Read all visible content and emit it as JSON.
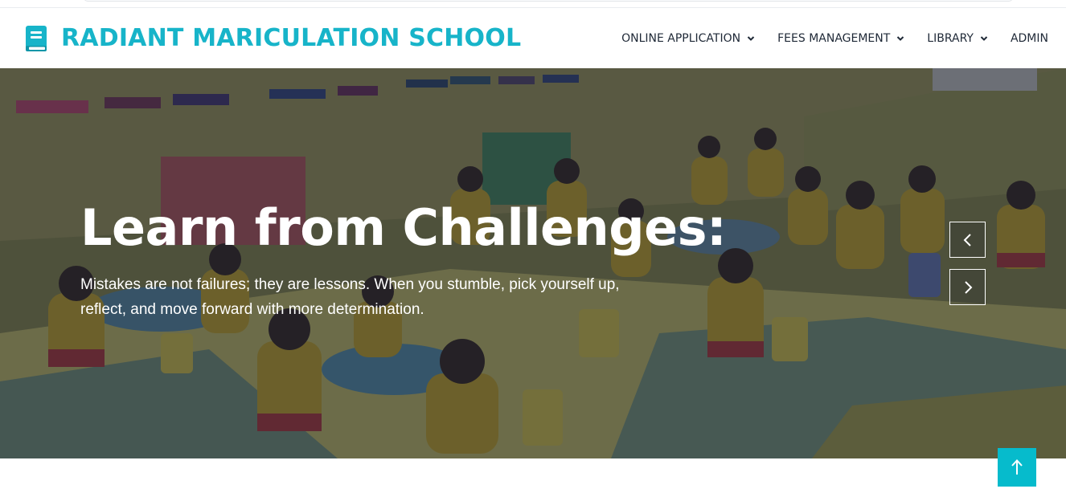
{
  "brand": {
    "name": "RADIANT MARICULATION SCHOOL",
    "icon": "book-icon",
    "color": "#17b4c9"
  },
  "nav": {
    "items": [
      {
        "label": "ONLINE APPLICATION",
        "has_dropdown": true
      },
      {
        "label": "FEES MANAGEMENT",
        "has_dropdown": true
      },
      {
        "label": "LIBRARY",
        "has_dropdown": true
      },
      {
        "label": "ADMIN",
        "has_dropdown": false
      }
    ]
  },
  "hero": {
    "title": "Learn from Challenges:",
    "text": "Mistakes are not failures; they are lessons. When you stumble, pick yourself up, reflect, and move forward with more determination.",
    "prev_icon": "chevron-left-icon",
    "next_icon": "chevron-right-icon"
  },
  "back_to_top": {
    "icon": "arrow-up-icon",
    "color": "#06bbcc"
  }
}
